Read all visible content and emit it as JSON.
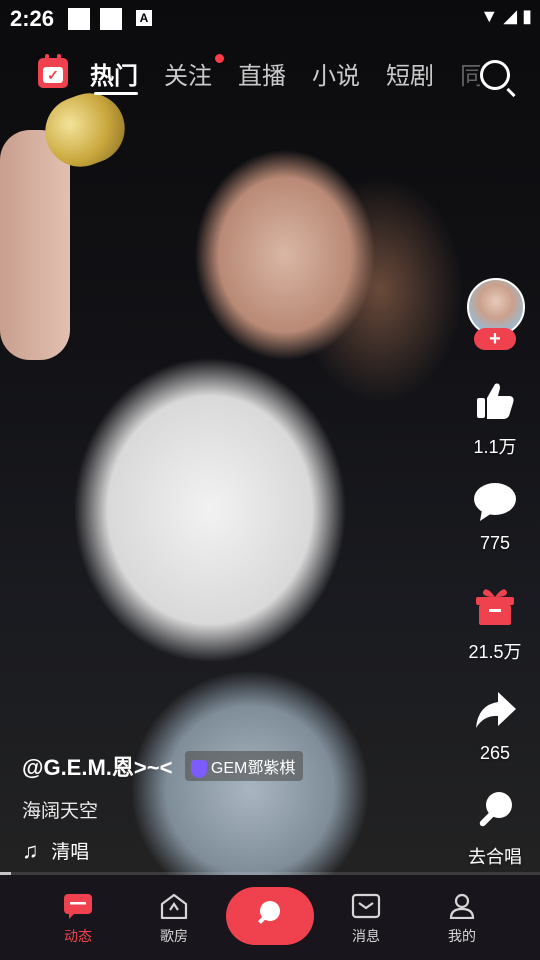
{
  "status_bar": {
    "time": "2:26"
  },
  "top_nav": {
    "tabs": [
      {
        "label": "热门",
        "active": true
      },
      {
        "label": "关注",
        "has_dot": true
      },
      {
        "label": "直播"
      },
      {
        "label": "小说"
      },
      {
        "label": "短剧"
      },
      {
        "label": "同"
      }
    ]
  },
  "video": {
    "username": "@G.E.M.恩>~<",
    "badge": "GEM鄧紫棋",
    "song_title": "海阔天空",
    "mode": "清唱",
    "progress_fraction": 0.02
  },
  "actions": {
    "likes": "1.1万",
    "comments": "775",
    "gifts": "21.5万",
    "shares": "265",
    "duet": "去合唱"
  },
  "bottom_nav": {
    "items": [
      {
        "label": "动态",
        "active": true
      },
      {
        "label": "歌房"
      },
      {
        "label": "消息"
      },
      {
        "label": "我的"
      }
    ]
  },
  "colors": {
    "accent": "#f0424e",
    "nav_bg": "#18161c"
  }
}
